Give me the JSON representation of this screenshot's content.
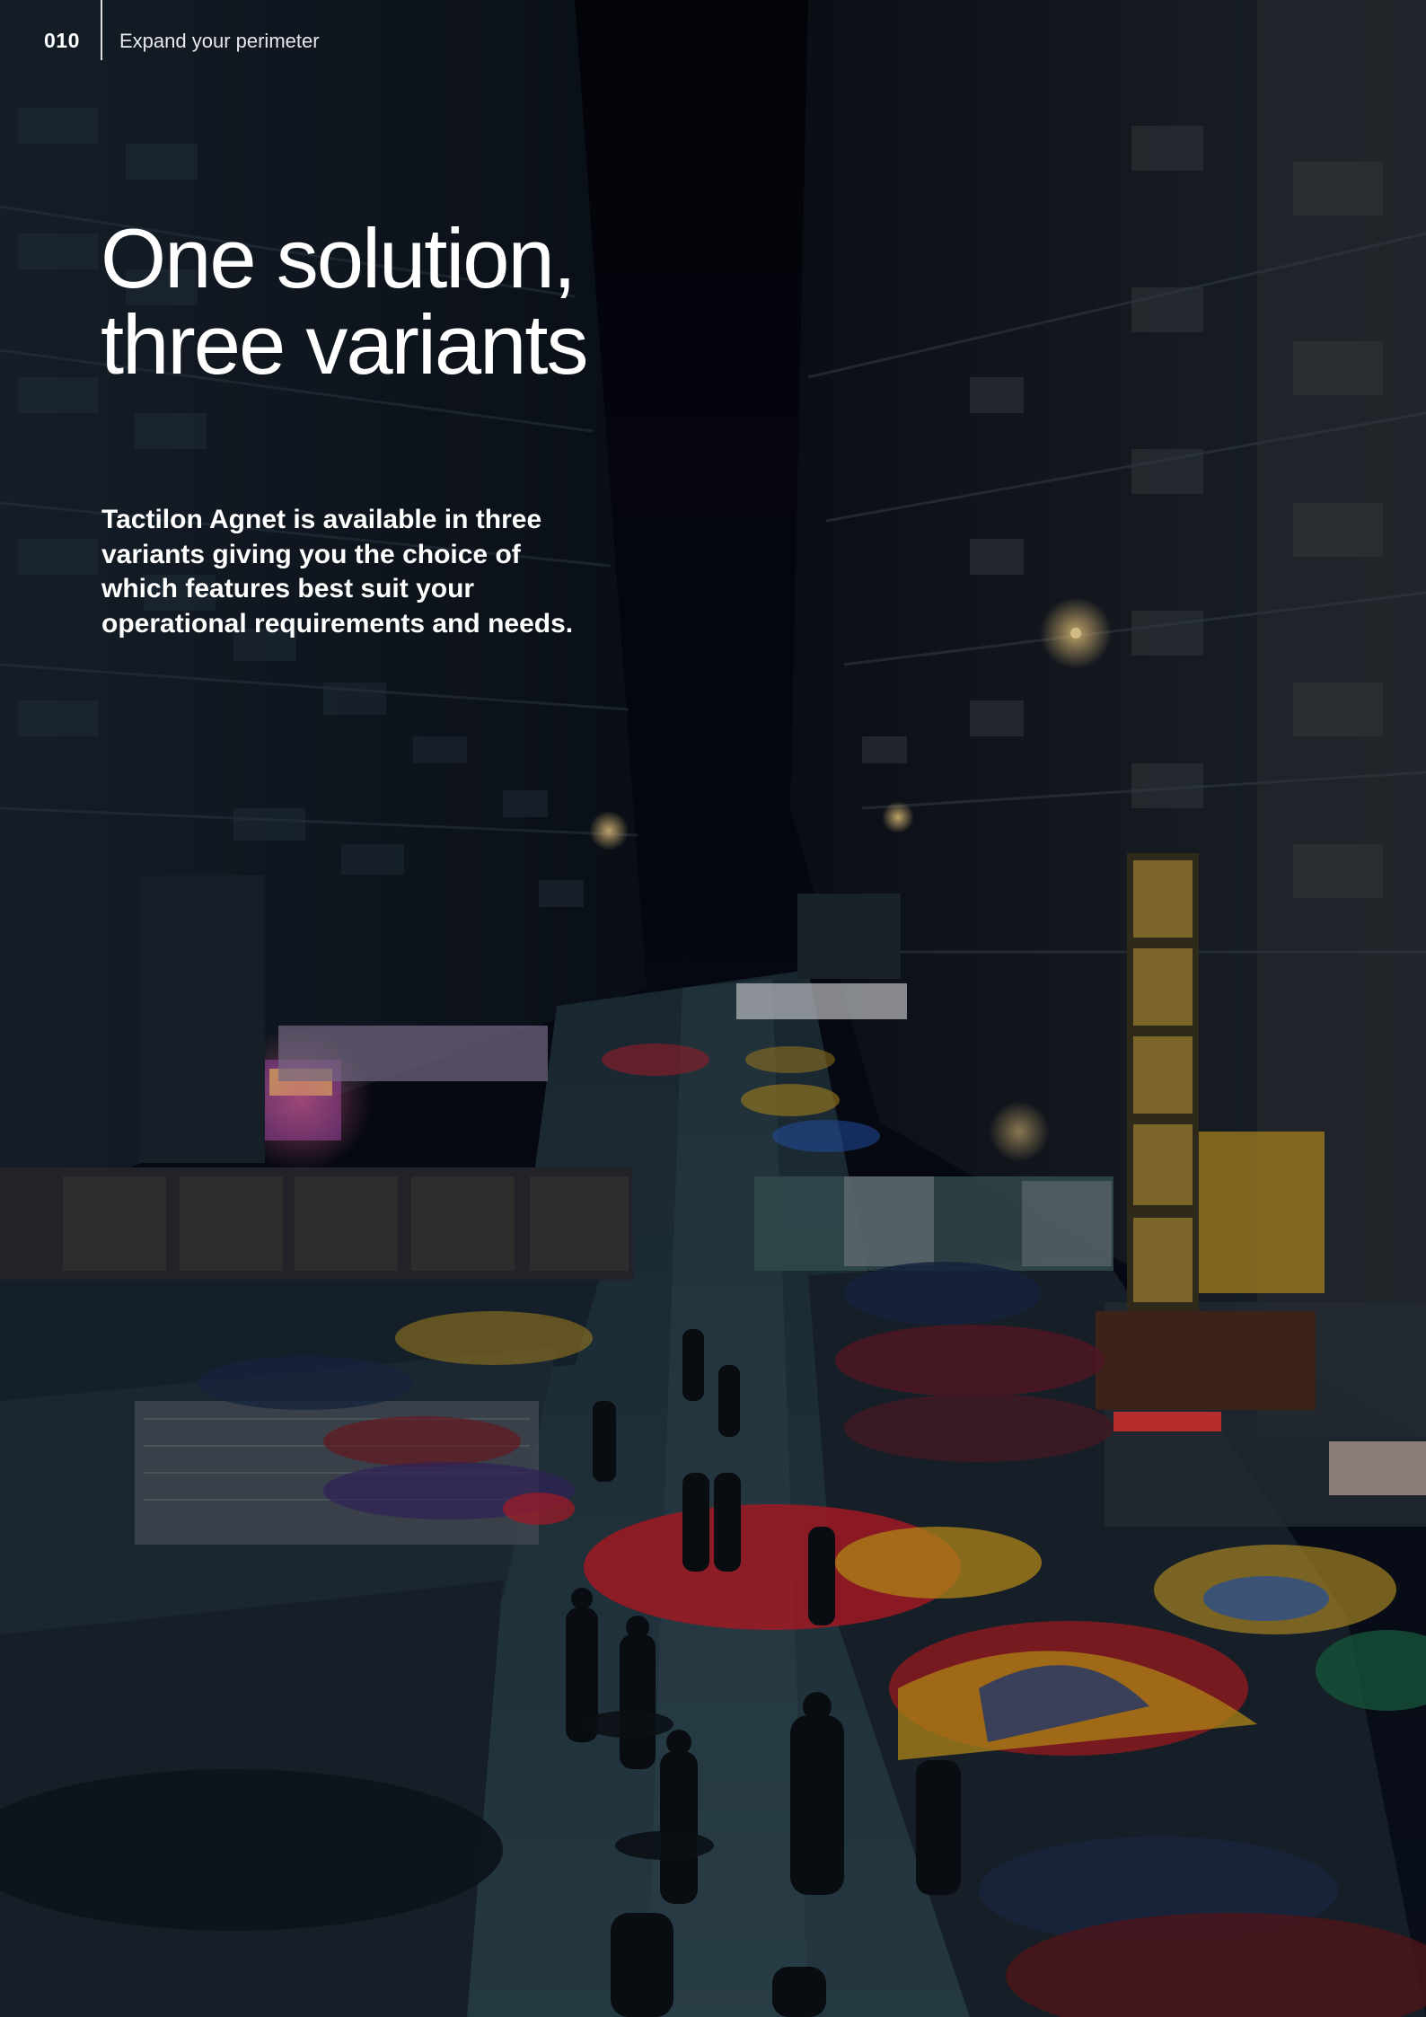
{
  "header": {
    "page_number": "010",
    "section_title": "Expand your perimeter"
  },
  "headline": {
    "line1": "One solution,",
    "line2": "three variants"
  },
  "intro": {
    "text": "Tactilon Agnet is available in three variants giving you the choice of which features best suit your operational requirements and needs."
  },
  "background": {
    "description_icon": "night-street-market-photo",
    "colors": {
      "sky": "#04050c",
      "buildings": "#1c2a36",
      "street": "#2c3f4a",
      "accent_red": "#b21e2c",
      "accent_yellow": "#d6a21c",
      "accent_blue": "#1d3f8a"
    }
  }
}
